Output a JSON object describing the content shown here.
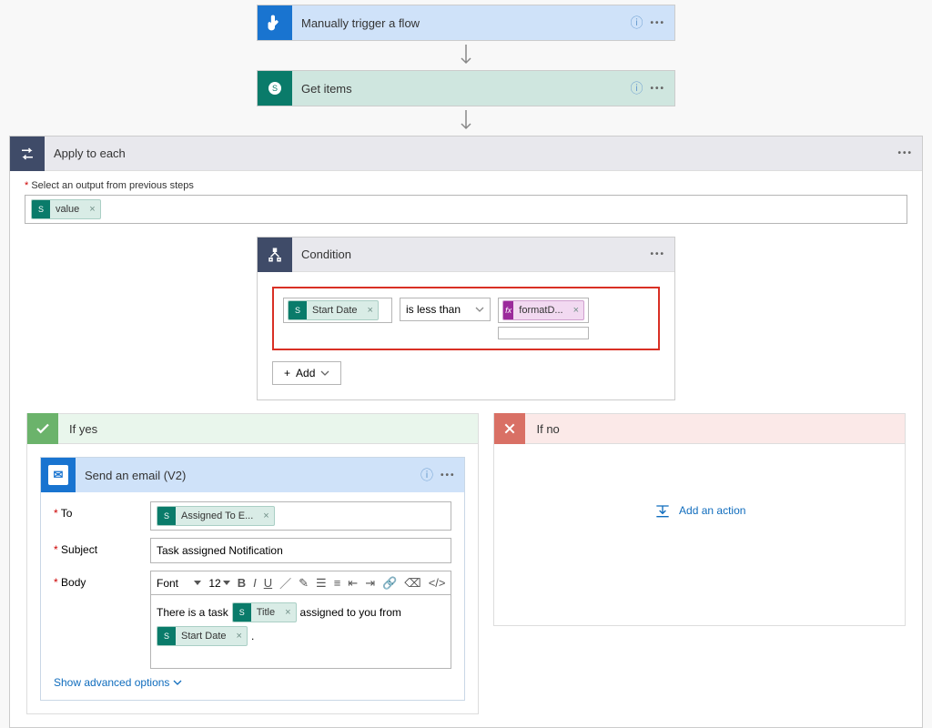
{
  "trigger": {
    "title": "Manually trigger a flow"
  },
  "getitems": {
    "title": "Get items"
  },
  "apply": {
    "title": "Apply to each",
    "output_label": "Select an output from previous steps",
    "token": "value"
  },
  "condition": {
    "title": "Condition",
    "left_token": "Start Date",
    "operator": "is less than",
    "right_token": "formatD...",
    "add_label": "Add"
  },
  "branches": {
    "yes": {
      "title": "If yes"
    },
    "no": {
      "title": "If no",
      "add_action": "Add an action"
    }
  },
  "email": {
    "title": "Send an email (V2)",
    "labels": {
      "to": "To",
      "subject": "Subject",
      "body": "Body"
    },
    "to_token": "Assigned To E...",
    "subject_value": "Task assigned Notification",
    "toolbar": {
      "font": "Font",
      "size": "12"
    },
    "body_text_1": "There is a task",
    "body_token_1": "Title",
    "body_text_2": "assigned to you from",
    "body_token_2": "Start Date",
    "body_text_3": ".",
    "advanced": "Show advanced options"
  }
}
